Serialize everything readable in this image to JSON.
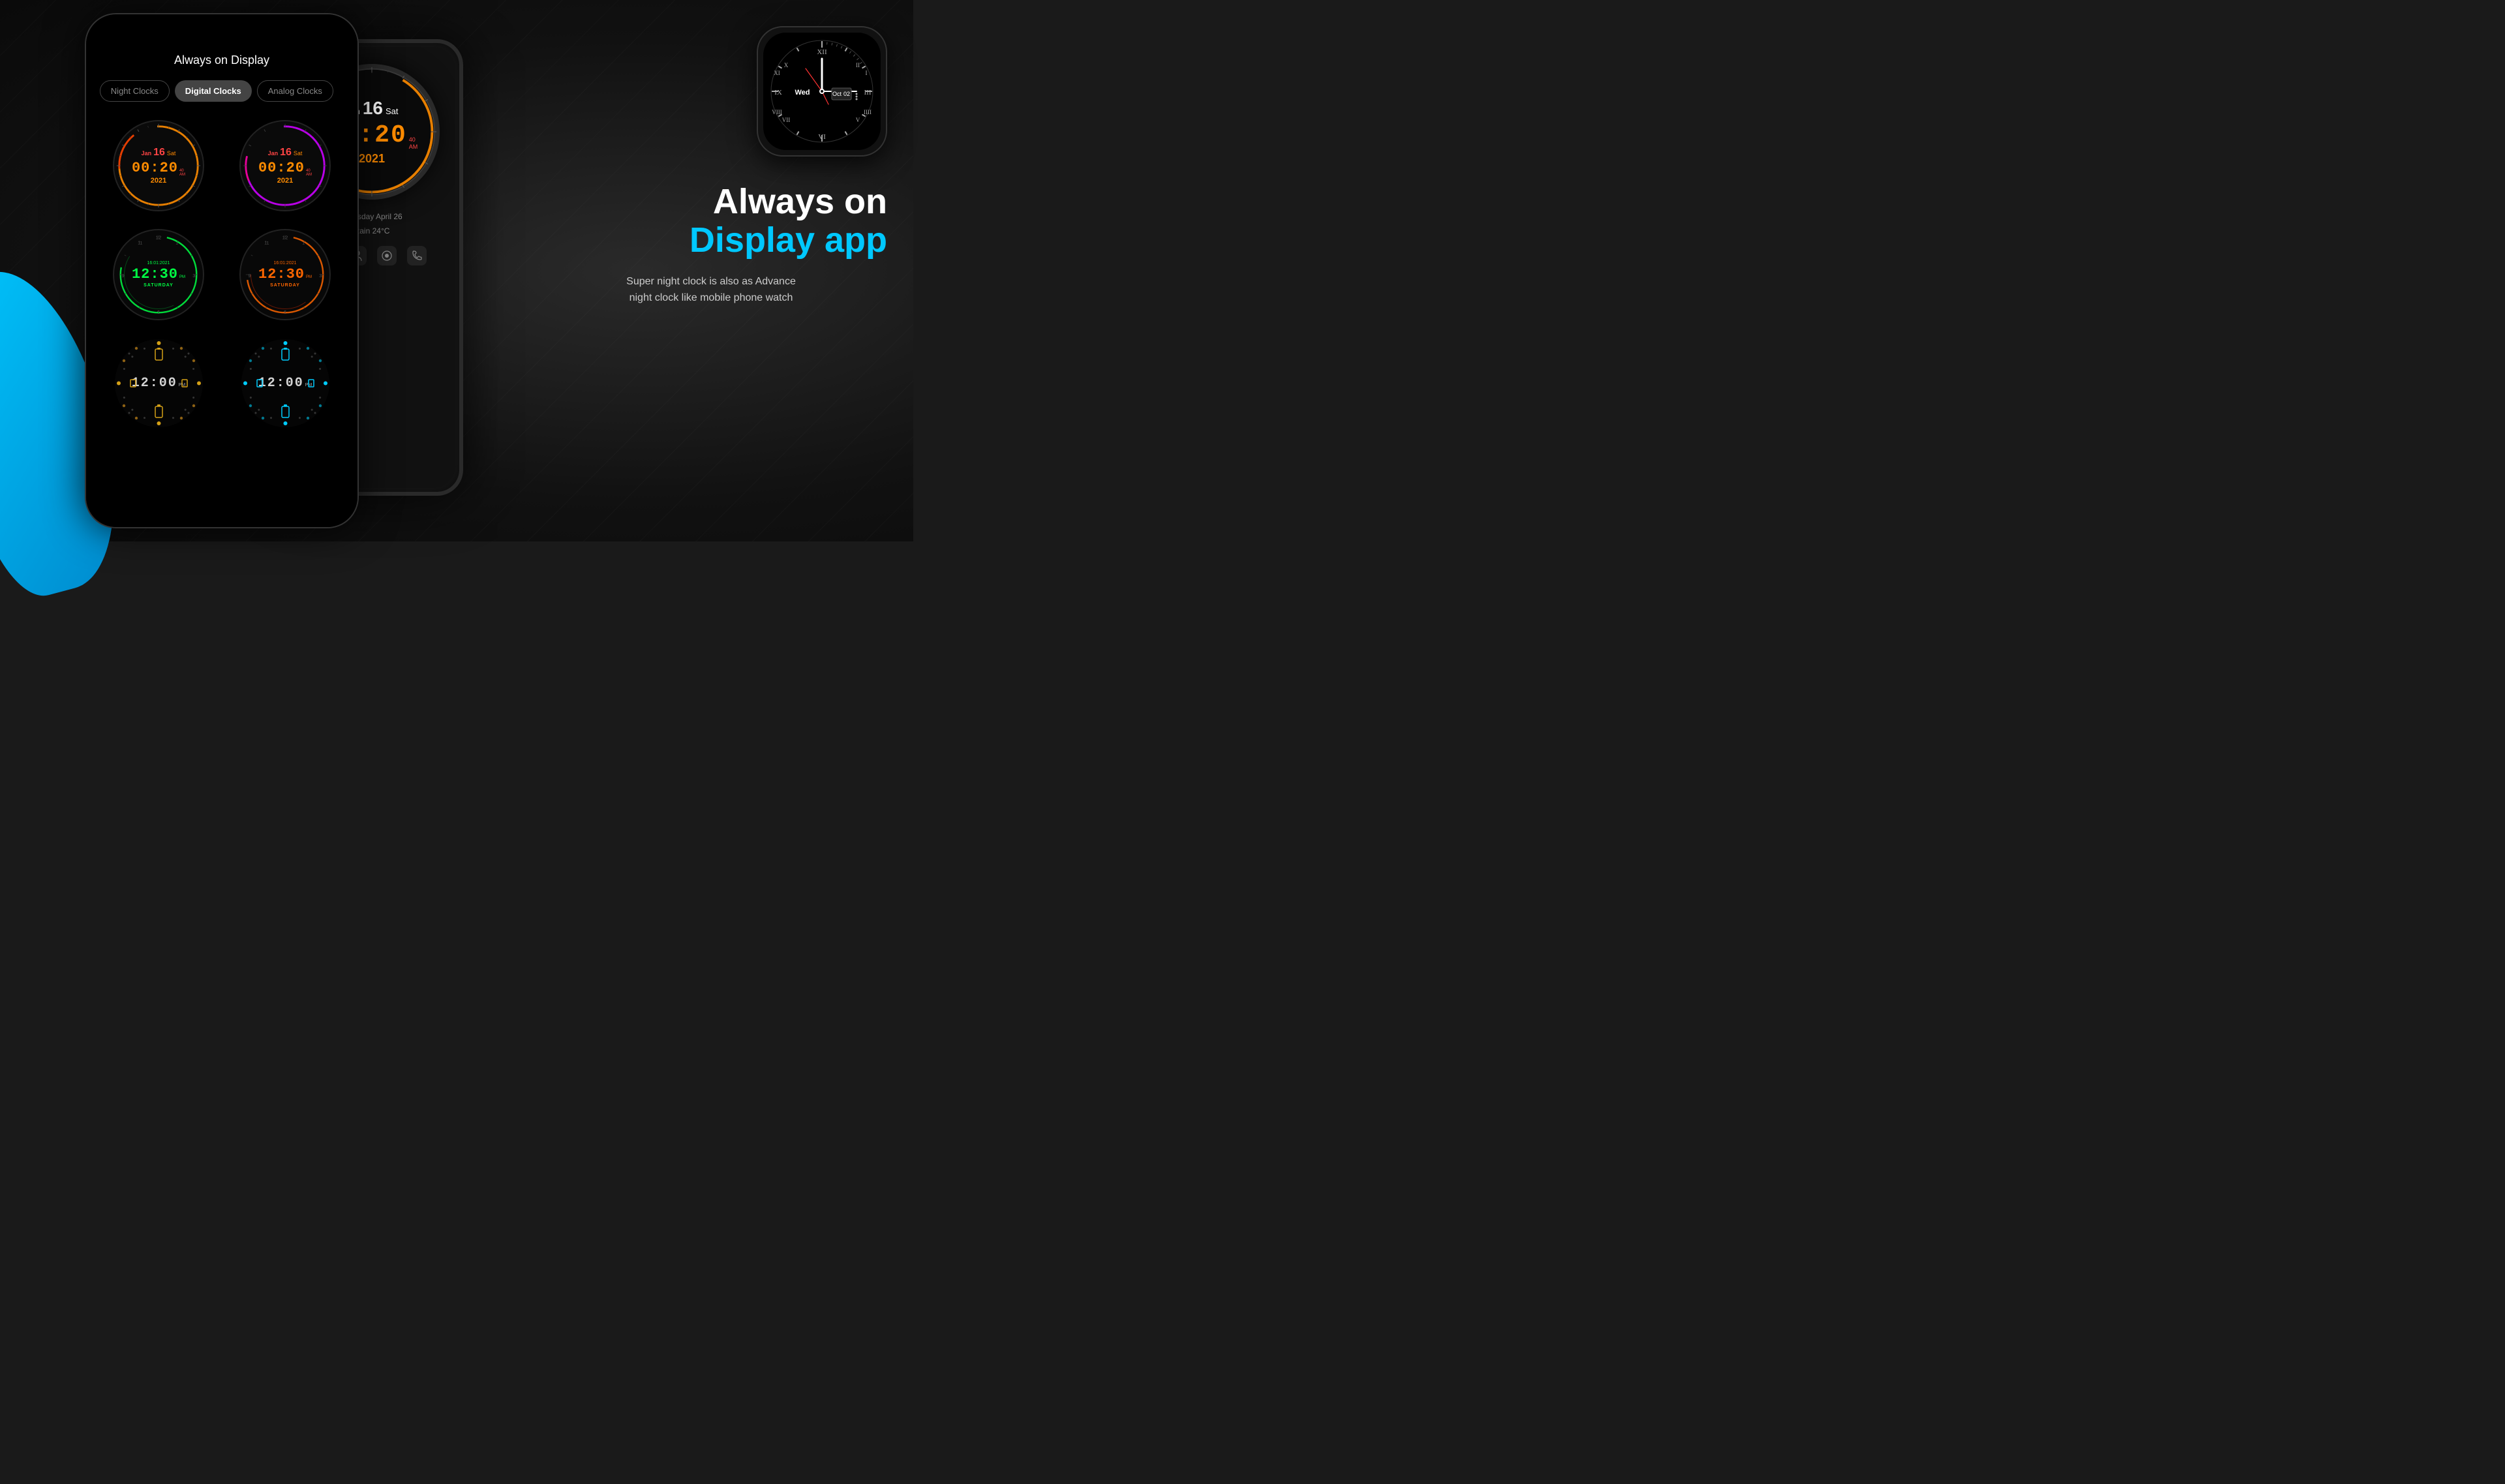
{
  "background": {
    "color": "#1a1a1a"
  },
  "phone1": {
    "title": "Always on Display",
    "tabs": [
      {
        "label": "Night Clocks",
        "active": false
      },
      {
        "label": "Digital Clocks",
        "active": true
      },
      {
        "label": "Analog Clocks",
        "active": false
      }
    ],
    "clocks": [
      {
        "type": "digital-arc",
        "arc_color": "orange",
        "date": "Jan 16 Sat",
        "time": "00:20",
        "ampm": "AM",
        "year": "2021",
        "time_color": "#ff8c00"
      },
      {
        "type": "digital-arc",
        "arc_color": "purple",
        "date": "Jan 16 Sat",
        "time": "00:20",
        "ampm": "AM",
        "year": "2021",
        "time_color": "#ff8c00"
      },
      {
        "type": "round-digital",
        "arc_color": "green",
        "date": "16:01:2021",
        "time": "12:30",
        "ampm": "PM",
        "day": "SATURDAY",
        "time_color": "#00ff44"
      },
      {
        "type": "round-digital",
        "arc_color": "orange2",
        "date": "16:01:2021",
        "time": "12:30",
        "ampm": "PM",
        "day": "SATURDAY",
        "time_color": "#ff6600"
      },
      {
        "type": "dot-ring",
        "dot_color": "gold",
        "time": "12:00",
        "ampm": "PM"
      },
      {
        "type": "dot-ring",
        "dot_color": "cyan",
        "time": "12:00",
        "ampm": "PM"
      }
    ]
  },
  "phone2": {
    "big_clock": {
      "date": "Jan 16 Sat",
      "time": "00:20",
      "ampm_small": "40",
      "ampm": "AM",
      "year": "2021"
    },
    "weather": {
      "day": "Thursday April 26",
      "condition": "Rain 24°C"
    }
  },
  "right": {
    "headline_line1": "Always on",
    "headline_line2": "Display app",
    "subtext_line1": "Super night clock is also as Advance",
    "subtext_line2": "night clock like mobile phone watch"
  },
  "watch": {
    "date_day": "Wed",
    "date_month": "Oct",
    "date_num": "02"
  },
  "blue_curve": true
}
